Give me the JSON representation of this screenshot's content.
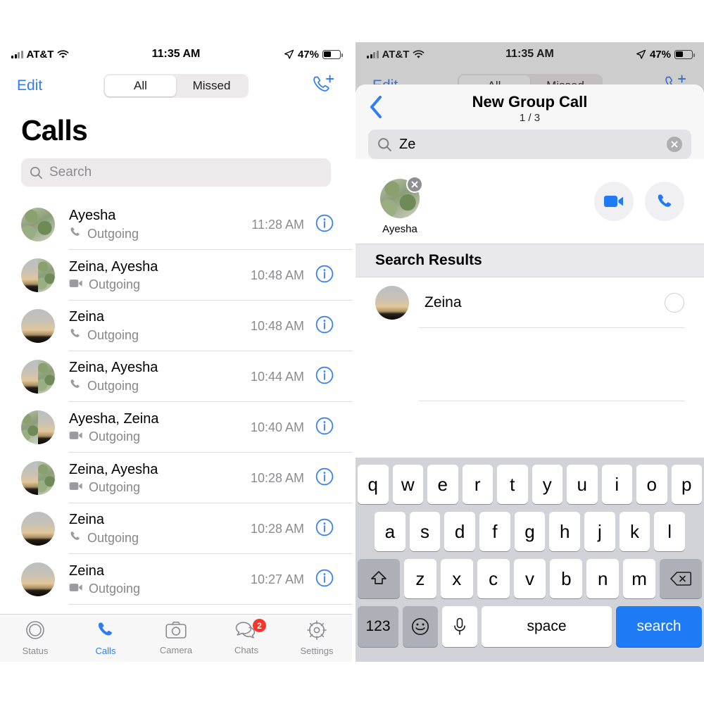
{
  "status_bar": {
    "carrier": "AT&T",
    "time": "11:35 AM",
    "battery_percent": "47%",
    "signal_icon": "cellular-bars-icon",
    "wifi_icon": "wifi-icon",
    "location_icon": "location-arrow-icon",
    "battery_icon": "battery-icon"
  },
  "left_screen": {
    "nav": {
      "edit_label": "Edit",
      "segments": [
        {
          "label": "All",
          "active": true
        },
        {
          "label": "Missed",
          "active": false
        }
      ],
      "new_call_icon": "phone-plus-icon"
    },
    "page_title": "Calls",
    "search": {
      "placeholder": "Search",
      "icon": "search-icon"
    },
    "calls": [
      {
        "name": "Ayesha",
        "type_icon": "phone-icon",
        "direction": "Outgoing",
        "time": "11:28 AM",
        "avatar": "leaf",
        "group": false
      },
      {
        "name": "Zeina, Ayesha",
        "type_icon": "video-icon",
        "direction": "Outgoing",
        "time": "10:48 AM",
        "avatar": "split-sunset-leaf",
        "group": true
      },
      {
        "name": "Zeina",
        "type_icon": "phone-icon",
        "direction": "Outgoing",
        "time": "10:48 AM",
        "avatar": "sunset",
        "group": false
      },
      {
        "name": "Zeina, Ayesha",
        "type_icon": "phone-icon",
        "direction": "Outgoing",
        "time": "10:44 AM",
        "avatar": "split-sunset-leaf",
        "group": true
      },
      {
        "name": "Ayesha, Zeina",
        "type_icon": "video-icon",
        "direction": "Outgoing",
        "time": "10:40 AM",
        "avatar": "split-leaf-sunset",
        "group": true
      },
      {
        "name": "Zeina, Ayesha",
        "type_icon": "video-icon",
        "direction": "Outgoing",
        "time": "10:28 AM",
        "avatar": "split-sunset-leaf",
        "group": true
      },
      {
        "name": "Zeina",
        "type_icon": "phone-icon",
        "direction": "Outgoing",
        "time": "10:28 AM",
        "avatar": "sunset",
        "group": false
      },
      {
        "name": "Zeina",
        "type_icon": "video-icon",
        "direction": "Outgoing",
        "time": "10:27 AM",
        "avatar": "sunset",
        "group": false
      }
    ],
    "tabs": [
      {
        "label": "Status",
        "icon": "status-rings-icon",
        "active": false,
        "badge": ""
      },
      {
        "label": "Calls",
        "icon": "phone-icon",
        "active": true,
        "badge": ""
      },
      {
        "label": "Camera",
        "icon": "camera-icon",
        "active": false,
        "badge": ""
      },
      {
        "label": "Chats",
        "icon": "chats-bubbles-icon",
        "active": false,
        "badge": "2"
      },
      {
        "label": "Settings",
        "icon": "gear-icon",
        "active": false,
        "badge": ""
      }
    ]
  },
  "right_screen": {
    "sheet": {
      "back_icon": "chevron-left-icon",
      "title": "New Group Call",
      "count": "1 / 3",
      "search": {
        "value": "Ze",
        "icon": "search-icon",
        "clear_icon": "clear-circle-icon"
      },
      "selected": [
        {
          "name": "Ayesha",
          "avatar": "leaf",
          "remove_icon": "close-circle-icon"
        }
      ],
      "actions": [
        {
          "icon": "video-call-icon",
          "name": "video-call-button"
        },
        {
          "icon": "audio-call-icon",
          "name": "audio-call-button"
        }
      ],
      "results_header": "Search Results",
      "results": [
        {
          "name": "Zeina",
          "avatar": "sunset",
          "selected": false
        }
      ]
    },
    "keyboard": {
      "row1": [
        "q",
        "w",
        "e",
        "r",
        "t",
        "y",
        "u",
        "i",
        "o",
        "p"
      ],
      "row2": [
        "a",
        "s",
        "d",
        "f",
        "g",
        "h",
        "j",
        "k",
        "l"
      ],
      "row3": [
        "z",
        "x",
        "c",
        "v",
        "b",
        "n",
        "m"
      ],
      "shift_icon": "shift-up-arrow-icon",
      "backspace_icon": "backspace-icon",
      "numbers_label": "123",
      "emoji_icon": "emoji-smiley-icon",
      "mic_icon": "microphone-icon",
      "space_label": "space",
      "return_label": "search"
    }
  },
  "colors": {
    "accent_blue": "#2f7cf6",
    "key_blue": "#1f7bf5",
    "badge_red": "#f8342b",
    "muted_gray": "#8b8b90"
  }
}
